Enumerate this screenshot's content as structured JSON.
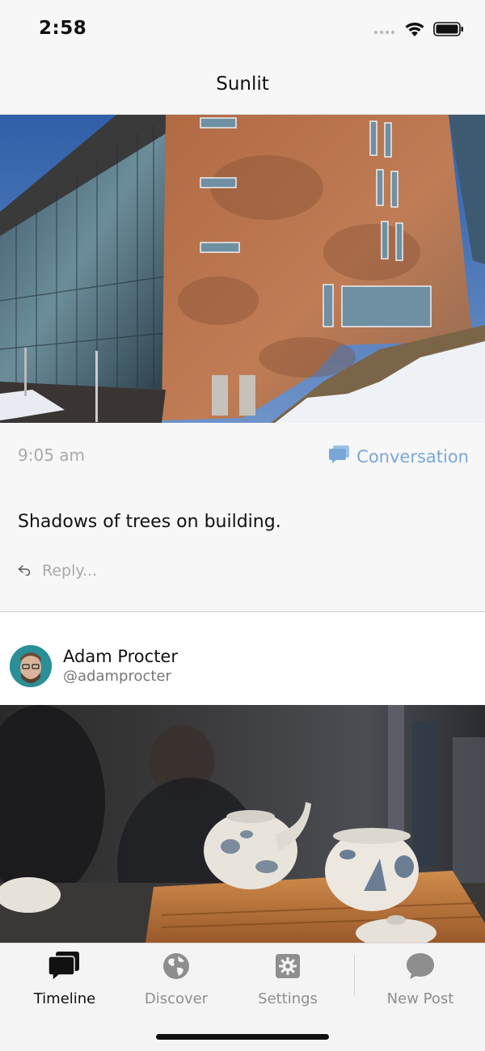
{
  "status_bar": {
    "time": "2:58",
    "icons": [
      "signal-icon",
      "wifi-icon",
      "battery-icon"
    ]
  },
  "nav": {
    "title": "Sunlit"
  },
  "post": {
    "image": "building-photo",
    "time": "9:05 am",
    "conversation_label": "Conversation",
    "text": "Shadows of trees on building.",
    "reply_placeholder": "Reply..."
  },
  "next_post": {
    "author_name": "Adam Procter",
    "author_handle": "@adamprocter",
    "image": "teapots-photo"
  },
  "tabs": [
    {
      "label": "Timeline",
      "icon": "timeline-icon",
      "active": true
    },
    {
      "label": "Discover",
      "icon": "globe-icon",
      "active": false
    },
    {
      "label": "Settings",
      "icon": "gear-icon",
      "active": false
    },
    {
      "label": "New Post",
      "icon": "new-post-icon",
      "active": false
    }
  ],
  "colors": {
    "accent": "#7aa8d6",
    "muted_text": "#a9a9a9",
    "background": "#f7f7f7"
  }
}
